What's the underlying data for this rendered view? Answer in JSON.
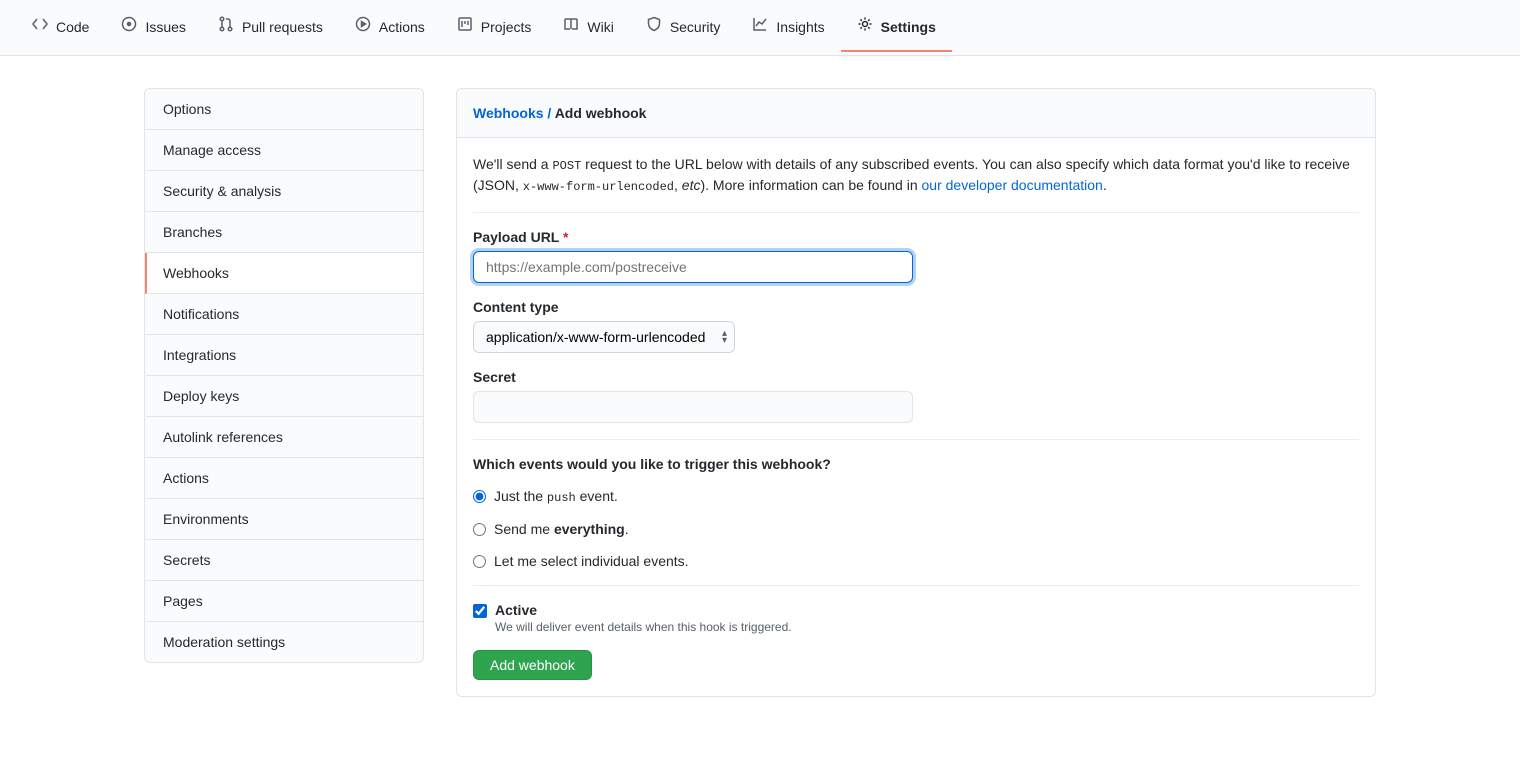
{
  "nav": {
    "tabs": [
      {
        "label": "Code"
      },
      {
        "label": "Issues"
      },
      {
        "label": "Pull requests"
      },
      {
        "label": "Actions"
      },
      {
        "label": "Projects"
      },
      {
        "label": "Wiki"
      },
      {
        "label": "Security"
      },
      {
        "label": "Insights"
      },
      {
        "label": "Settings"
      }
    ]
  },
  "sidebar": {
    "items": [
      "Options",
      "Manage access",
      "Security & analysis",
      "Branches",
      "Webhooks",
      "Notifications",
      "Integrations",
      "Deploy keys",
      "Autolink references",
      "Actions",
      "Environments",
      "Secrets",
      "Pages",
      "Moderation settings"
    ]
  },
  "header": {
    "breadcrumb_link": "Webhooks",
    "breadcrumb_sep": " / ",
    "title": "Add webhook"
  },
  "intro": {
    "part1": "We'll send a ",
    "code1": "POST",
    "part2": " request to the URL below with details of any subscribed events. You can also specify which data format you'd like to receive (JSON, ",
    "code2": "x-www-form-urlencoded",
    "part3": ", ",
    "em": "etc",
    "part4": "). More information can be found in ",
    "link": "our developer documentation",
    "part5": "."
  },
  "form": {
    "payload_label": "Payload URL",
    "required_mark": "*",
    "payload_placeholder": "https://example.com/postreceive",
    "content_type_label": "Content type",
    "content_type_value": "application/x-www-form-urlencoded",
    "secret_label": "Secret",
    "events_heading": "Which events would you like to trigger this webhook?",
    "radio1_pre": "Just the ",
    "radio1_code": "push",
    "radio1_post": " event.",
    "radio2_pre": "Send me ",
    "radio2_strong": "everything",
    "radio2_post": ".",
    "radio3": "Let me select individual events.",
    "active_label": "Active",
    "active_desc": "We will deliver event details when this hook is triggered.",
    "submit": "Add webhook"
  }
}
